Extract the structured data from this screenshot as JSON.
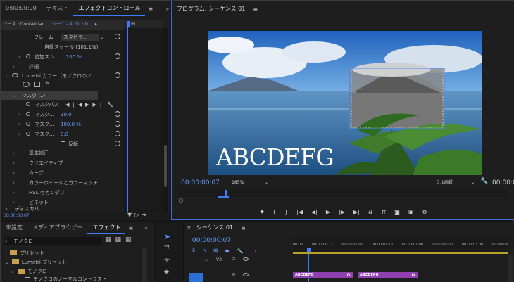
{
  "top_left": {
    "time": "0:00:00:00",
    "tab_text": "テキスト",
    "tab_effect": "エフェクトコントロール",
    "menu": "≡",
    "more": "»"
  },
  "effect_controls": {
    "source": "ソース・DockAtitlan...",
    "sequence": "シーケンス 01 • D...",
    "frame_label": "フレーム",
    "frame_value": "スタビラ...",
    "auto_scale": "自動スケール (101.1%)",
    "add_label": "追加スム...",
    "add_value": "100 %",
    "detail": "詳細",
    "lumetri": "Lumetri カラー（モノクロのノ...",
    "mask": "マスク (1)",
    "mask_path": "マスクパス",
    "mask_rows": [
      {
        "label": "マスク...",
        "value": "10.0"
      },
      {
        "label": "マスク...",
        "value": "100.0 %"
      },
      {
        "label": "マスク...",
        "value": "0.0"
      }
    ],
    "invert": "反転",
    "sections": [
      "基本補正",
      "クリエイティブ",
      "カーブ",
      "カラーホイールとカラーマッチ",
      "HSL セカンダリ",
      "ビネット",
      "ディスカバ"
    ],
    "timecode": "00:00:00:07",
    "mini_ruler": "00"
  },
  "program": {
    "title": "プログラム: シーケンス 01",
    "menu": "≡",
    "overlay_text": "ABCDEFG",
    "timecode": "00:00:00:07",
    "zoom": "185%",
    "quality": "フル画質",
    "end_time": "00:00:0"
  },
  "bottom_left": {
    "tab1": "未設定",
    "tab2": "メディアブラウザー",
    "tab3": "エフェクト",
    "menu": "≡",
    "more": "»",
    "search": "モノクロ",
    "tree": [
      "プリセット",
      "Lumetri プリセット",
      "モノクロ",
      "モノクロのノーマルコントラスト"
    ]
  },
  "timeline": {
    "title": "シーケンス 01",
    "menu": "≡",
    "timecode": "00:00:00:07",
    "ruler": [
      "00:00",
      "00:00:00:12",
      "00:00:01:00",
      "00:00:01:12",
      "00:00:02:00",
      "00:00:02:12",
      "00:00:03:00",
      "00:00:03"
    ],
    "track": "V3",
    "clips": [
      "ABCDEFG",
      "ABCDEFG"
    ],
    "fx": "fx"
  }
}
